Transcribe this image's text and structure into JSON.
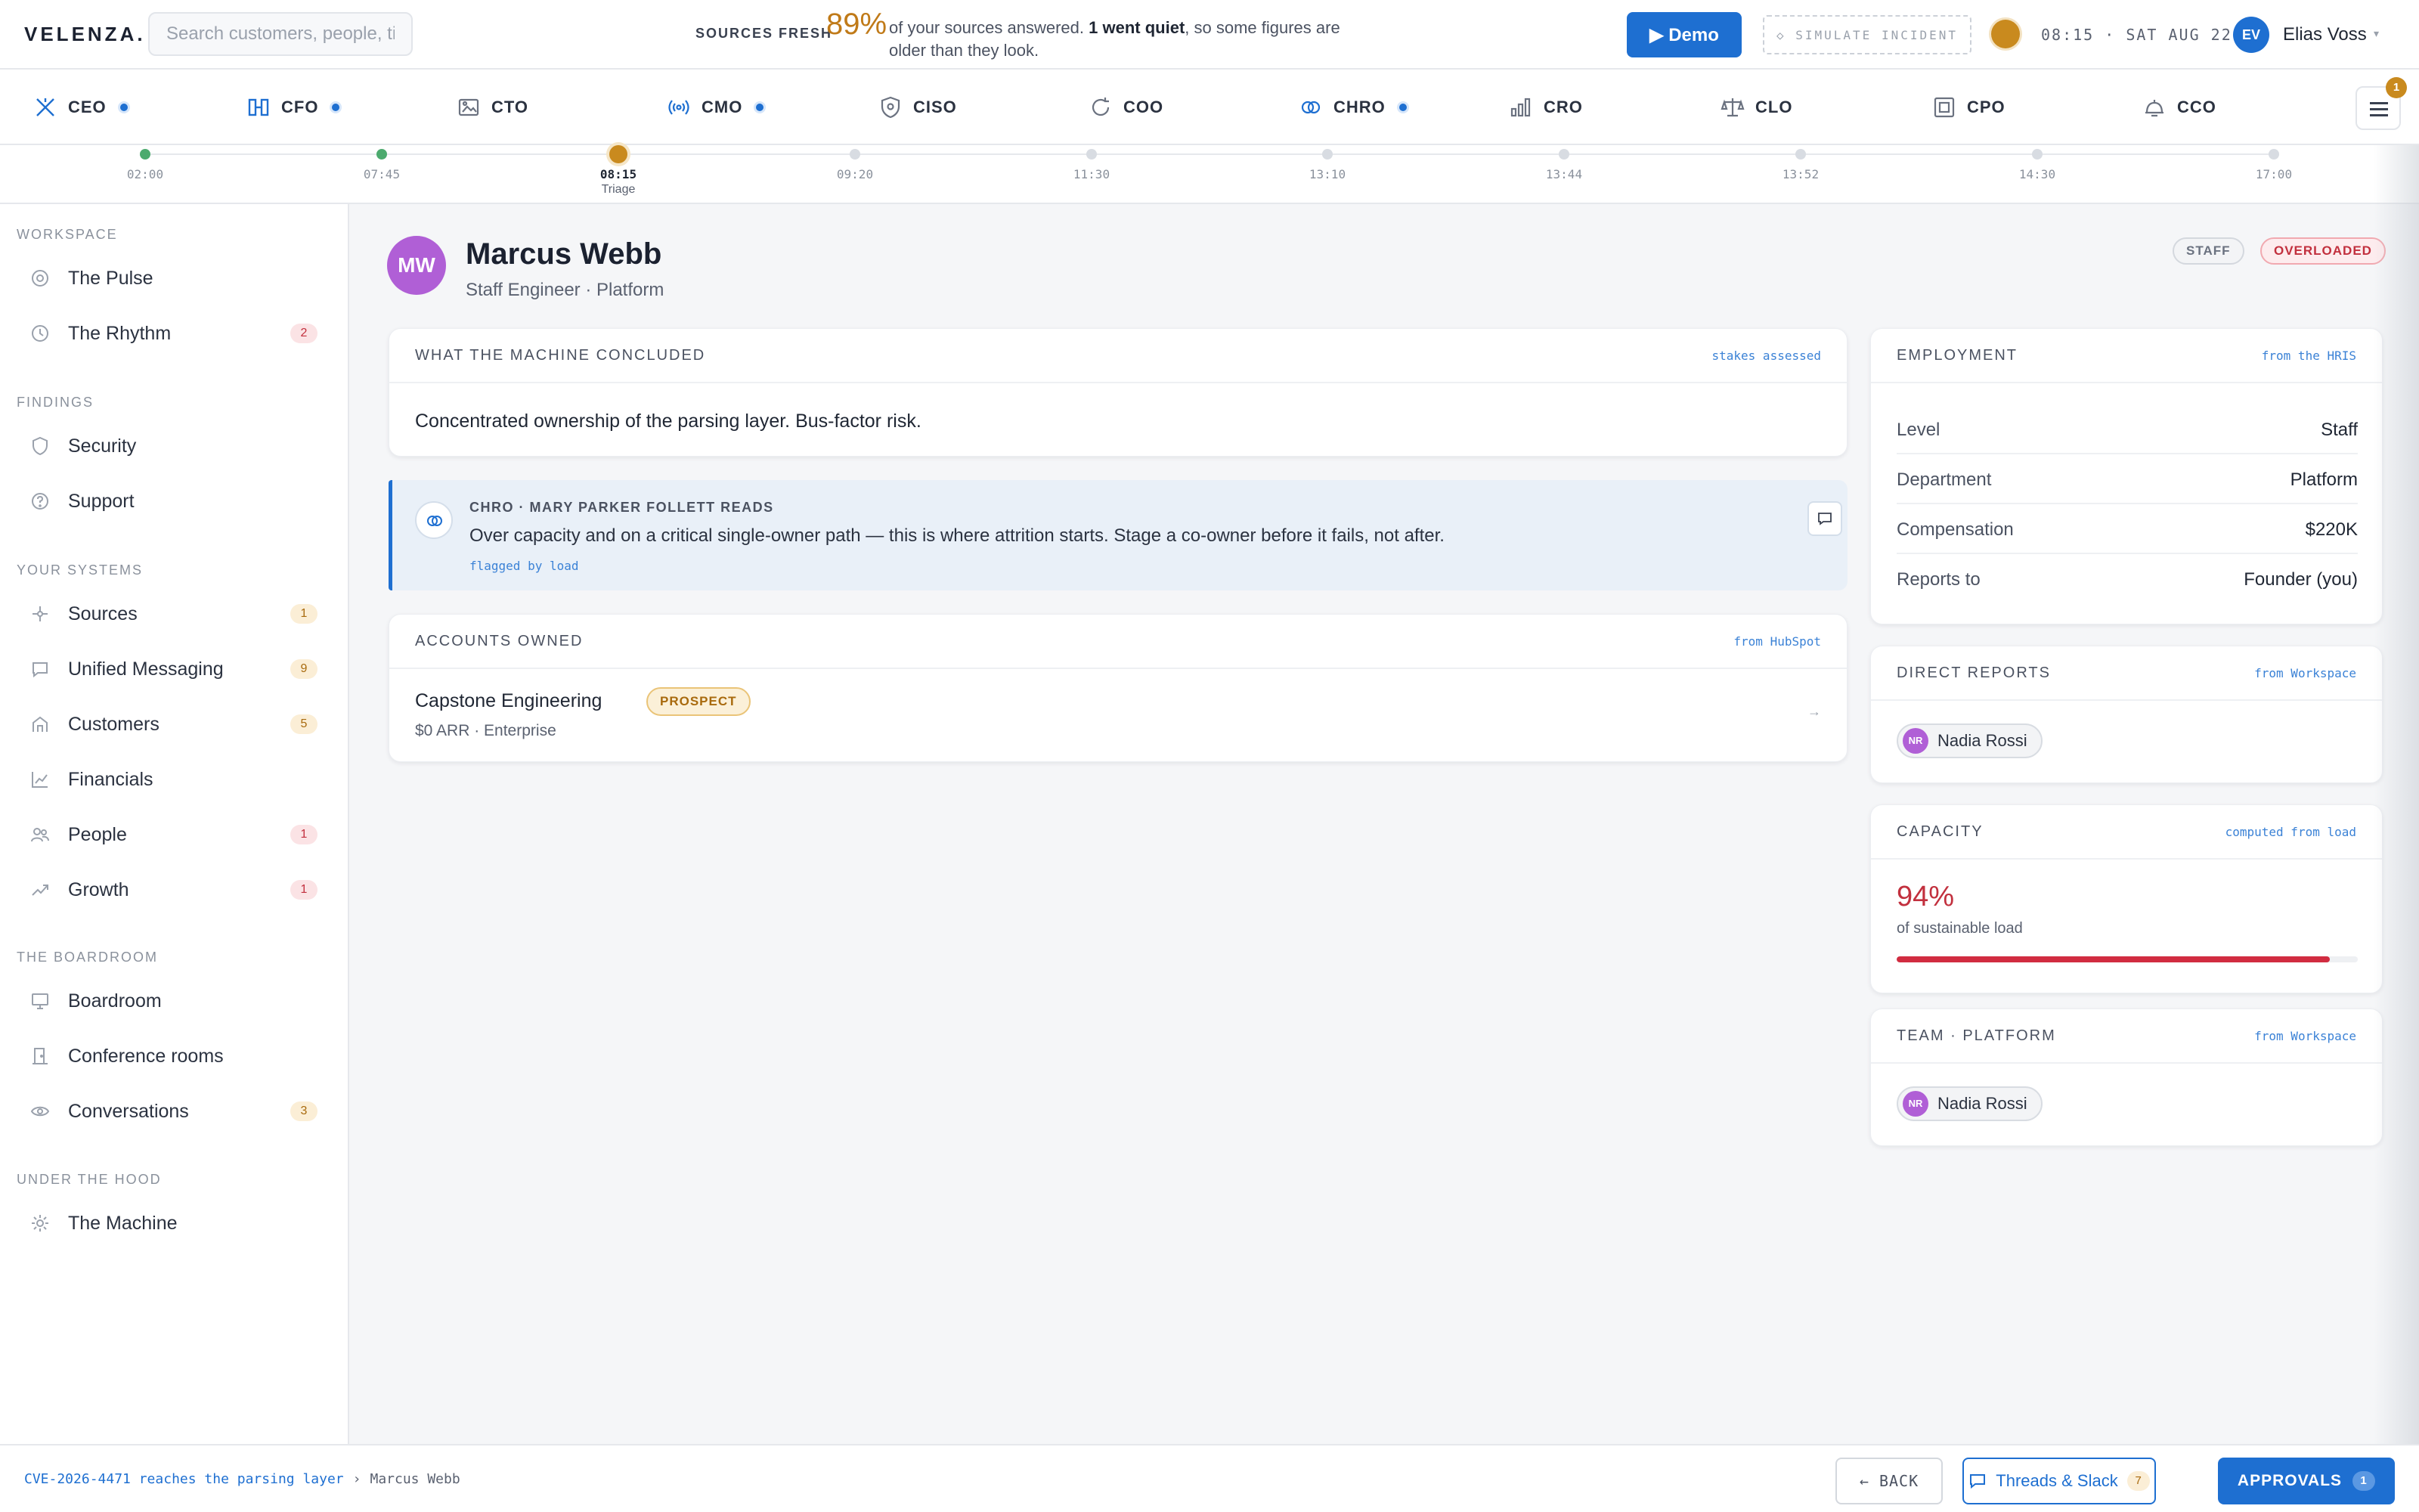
{
  "brand": {
    "logo": "VELENZA.",
    "accent": "#1e6fd1",
    "warning": "#c98a1e",
    "danger": "#c2303e"
  },
  "search": {
    "placeholder": "Search customers, people, ti"
  },
  "freshness": {
    "label": "SOURCES FRESH",
    "percent": "89%",
    "text_before": "of your sources answered.",
    "bold": "1 went quiet",
    "text_after": ", so some figures are older than they look."
  },
  "header": {
    "demo_label": "▶ Demo",
    "simulate_label": "◇ SIMULATE INCIDENT",
    "clock": "08:15 · SAT AUG 22",
    "user": {
      "initials": "EV",
      "name": "Elias Voss"
    },
    "menu_badge": "1"
  },
  "roles": [
    {
      "label": "CEO",
      "icon": "x-icon",
      "live": true
    },
    {
      "label": "CFO",
      "icon": "columns-icon",
      "live": true
    },
    {
      "label": "CTO",
      "icon": "image-icon",
      "live": false
    },
    {
      "label": "CMO",
      "icon": "broadcast-icon",
      "live": true
    },
    {
      "label": "CISO",
      "icon": "shield-icon",
      "live": false
    },
    {
      "label": "COO",
      "icon": "refresh-icon",
      "live": false
    },
    {
      "label": "CHRO",
      "icon": "rings-icon",
      "live": true
    },
    {
      "label": "CRO",
      "icon": "bars-icon",
      "live": false
    },
    {
      "label": "CLO",
      "icon": "scales-icon",
      "live": false
    },
    {
      "label": "CPO",
      "icon": "square-icon",
      "live": false
    },
    {
      "label": "CCO",
      "icon": "bell-icon",
      "live": false
    }
  ],
  "timeline": [
    {
      "time": "02:00",
      "state": "done",
      "sub": ""
    },
    {
      "time": "07:45",
      "state": "done",
      "sub": ""
    },
    {
      "time": "08:15",
      "state": "now",
      "sub": "Triage"
    },
    {
      "time": "09:20",
      "state": "future",
      "sub": ""
    },
    {
      "time": "11:30",
      "state": "future",
      "sub": ""
    },
    {
      "time": "13:10",
      "state": "future",
      "sub": ""
    },
    {
      "time": "13:44",
      "state": "future",
      "sub": ""
    },
    {
      "time": "13:52",
      "state": "future",
      "sub": ""
    },
    {
      "time": "14:30",
      "state": "future",
      "sub": ""
    },
    {
      "time": "17:00",
      "state": "future",
      "sub": ""
    }
  ],
  "sidebar": {
    "sections": [
      {
        "title": "WORKSPACE",
        "items": [
          {
            "label": "The Pulse",
            "icon": "pulse-icon",
            "badge": "",
            "tone": ""
          },
          {
            "label": "The Rhythm",
            "icon": "clock-icon",
            "badge": "2",
            "tone": "red"
          }
        ]
      },
      {
        "title": "FINDINGS",
        "items": [
          {
            "label": "Security",
            "icon": "shield-icon",
            "badge": "",
            "tone": ""
          },
          {
            "label": "Support",
            "icon": "help-icon",
            "badge": "",
            "tone": ""
          }
        ]
      },
      {
        "title": "YOUR SYSTEMS",
        "items": [
          {
            "label": "Sources",
            "icon": "hub-icon",
            "badge": "1",
            "tone": "amber"
          },
          {
            "label": "Unified Messaging",
            "icon": "message-icon",
            "badge": "9",
            "tone": "amber"
          },
          {
            "label": "Customers",
            "icon": "building-icon",
            "badge": "5",
            "tone": "amber"
          },
          {
            "label": "Financials",
            "icon": "line-chart-icon",
            "badge": "",
            "tone": ""
          },
          {
            "label": "People",
            "icon": "people-icon",
            "badge": "1",
            "tone": "red"
          },
          {
            "label": "Growth",
            "icon": "trend-up-icon",
            "badge": "1",
            "tone": "red"
          }
        ]
      },
      {
        "title": "THE BOARDROOM",
        "items": [
          {
            "label": "Boardroom",
            "icon": "monitor-icon",
            "badge": "",
            "tone": ""
          },
          {
            "label": "Conference rooms",
            "icon": "door-icon",
            "badge": "",
            "tone": ""
          },
          {
            "label": "Conversations",
            "icon": "eye-icon",
            "badge": "3",
            "tone": "amber"
          }
        ]
      },
      {
        "title": "UNDER THE HOOD",
        "items": [
          {
            "label": "The Machine",
            "icon": "cog-icon",
            "badge": "",
            "tone": ""
          }
        ]
      }
    ]
  },
  "person": {
    "initials": "MW",
    "name": "Marcus Webb",
    "role": "Staff Engineer · Platform",
    "tags": {
      "level": "STAFF",
      "status": "OVERLOADED"
    }
  },
  "conclusion": {
    "title": "WHAT THE MACHINE CONCLUDED",
    "source": "stakes assessed",
    "text": "Concentrated ownership of the parsing layer. Bus-factor risk."
  },
  "chro_note": {
    "title": "CHRO · MARY PARKER FOLLETT READS",
    "text": "Over capacity and on a critical single-owner path — this is where attrition starts. Stage a co-owner before it fails, not after.",
    "flag": "flagged by load"
  },
  "accounts": {
    "title": "ACCOUNTS OWNED",
    "source": "from HubSpot",
    "items": [
      {
        "name": "Capstone Engineering",
        "tag": "PROSPECT",
        "meta": "$0 ARR · Enterprise",
        "arrow": "→"
      }
    ]
  },
  "employment": {
    "title": "EMPLOYMENT",
    "source": "from the HRIS",
    "rows": [
      {
        "k": "Level",
        "v": "Staff"
      },
      {
        "k": "Department",
        "v": "Platform"
      },
      {
        "k": "Compensation",
        "v": "$220K"
      },
      {
        "k": "Reports to",
        "v": "Founder (you)"
      }
    ]
  },
  "direct_reports": {
    "title": "DIRECT REPORTS",
    "source": "from Workspace",
    "people": [
      {
        "initials": "NR",
        "name": "Nadia Rossi"
      }
    ]
  },
  "capacity": {
    "title": "CAPACITY",
    "source": "computed from load",
    "percent_text": "94%",
    "label": "of sustainable load",
    "fraction": 0.94
  },
  "team": {
    "title": "TEAM · PLATFORM",
    "source": "from Workspace",
    "people": [
      {
        "initials": "NR",
        "name": "Nadia Rossi"
      }
    ]
  },
  "footer": {
    "crumb_link": "CVE-2026-4471 reaches the parsing layer",
    "crumb_sep": "›",
    "crumb_current": "Marcus Webb",
    "back_label": "← BACK",
    "threads_label": "Threads & Slack",
    "threads_count": "7",
    "approvals_label": "APPROVALS",
    "approvals_count": "1"
  }
}
